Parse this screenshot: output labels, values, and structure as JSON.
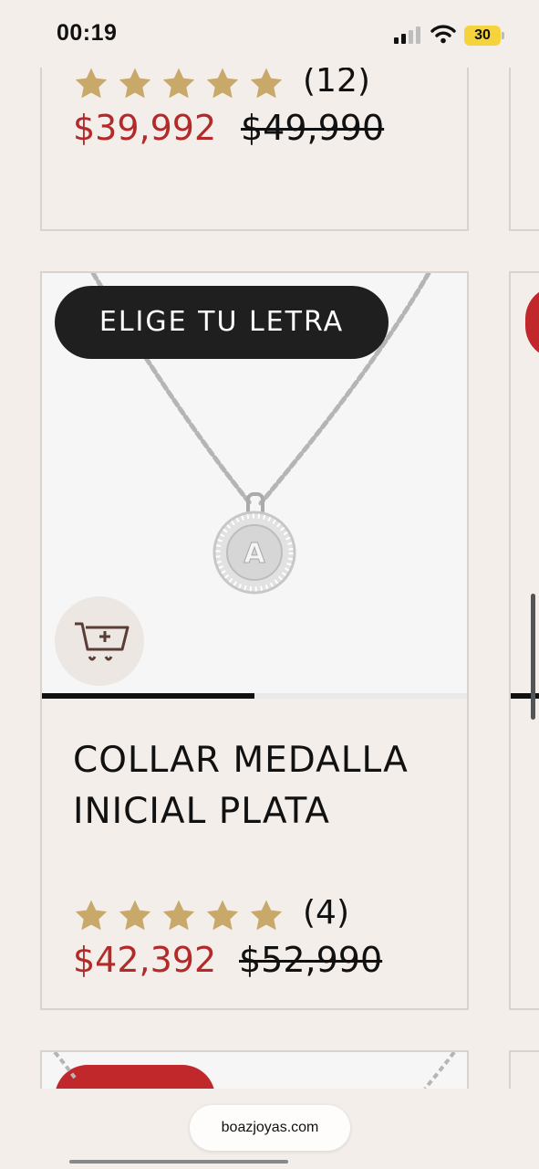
{
  "status_bar": {
    "time": "00:19",
    "battery": "30",
    "icons": [
      "signal-icon",
      "wifi-icon",
      "battery-icon"
    ]
  },
  "products": [
    {
      "rating_stars": 5,
      "review_count": "(12)",
      "sale_price": "$39,992",
      "original_price": "$49,990"
    },
    {
      "badge": "ELIGE TU LETRA",
      "title": "COLLAR MEDALLA INICIAL PLATA",
      "rating_stars": 5,
      "review_count": "(4)",
      "sale_price": "$42,392",
      "original_price": "$52,990",
      "image_progress": 0.5,
      "pendant_letter": "A"
    }
  ],
  "browser": {
    "url": "boazjoyas.com"
  },
  "colors": {
    "background": "#f3eeea",
    "sale": "#b22a2a",
    "star": "#c9a96a",
    "pill": "#1f1f1f",
    "badge_red": "#c0282b"
  }
}
